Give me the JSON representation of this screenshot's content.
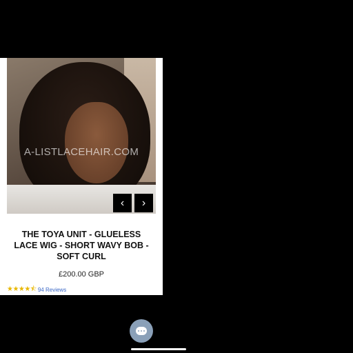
{
  "product": {
    "image_watermark": "A-LISTLACEHAIR.COM",
    "title": "THE TOYA UNIT - GLUELESS LACE WIG - SHORT WAVY BOB - SOFT CURL",
    "price": "£200.00 GBP",
    "rating_stars": "★★★★⯪",
    "reviews_label": "94 Reviews"
  },
  "carousel": {
    "prev_icon": "‹",
    "next_icon": "›"
  },
  "chat": {
    "icon": "chat-bubble-icon"
  }
}
